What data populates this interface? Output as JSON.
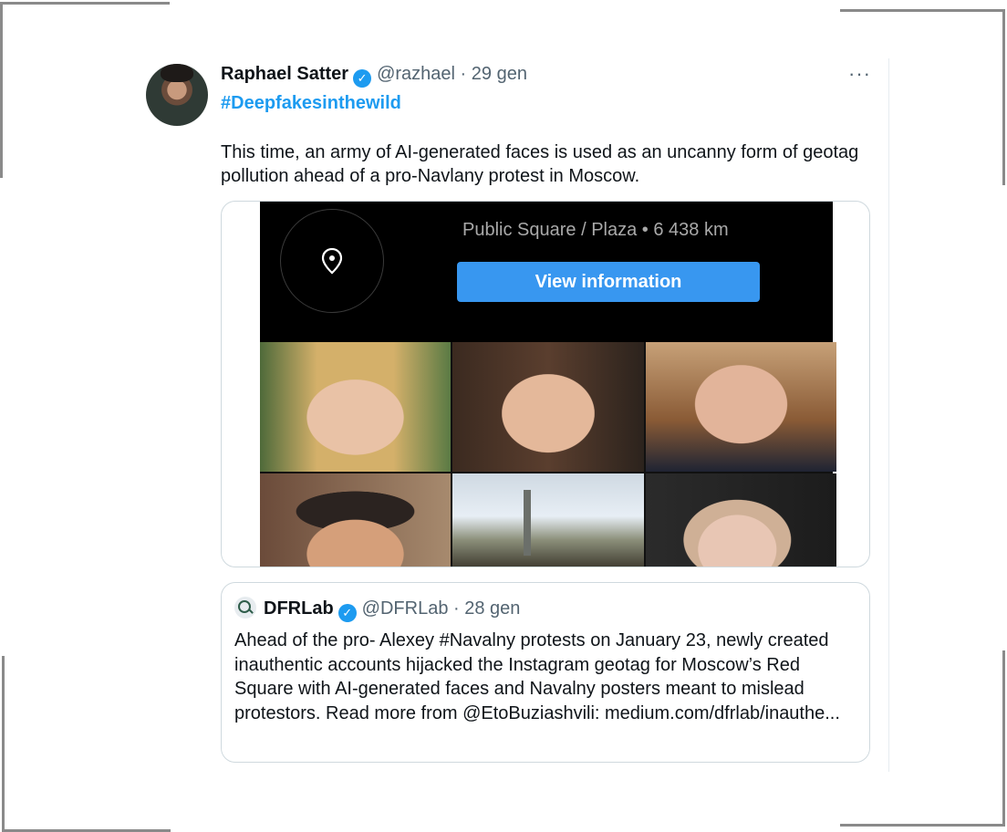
{
  "tweet": {
    "author_name": "Raphael Satter",
    "verified_glyph": "✓",
    "handle": "@razhael",
    "separator": "·",
    "time": "29 gen",
    "more_glyph": "···",
    "hashtag": "#Deepfakesinthewild",
    "text": "This time, an army of AI-generated faces is used as an uncanny form of geotag pollution ahead of a pro-Navlany protest in Moscow."
  },
  "media": {
    "location_text": "Public Square / Plaza • 6 438 km",
    "view_button": "View information",
    "pin_icon": "location-pin-icon"
  },
  "quote": {
    "author_name": "DFRLab",
    "verified_glyph": "✓",
    "handle": "@DFRLab",
    "separator": "·",
    "time": "28 gen",
    "text": "Ahead of the pro- Alexey #Navalny protests on January 23, newly created inauthentic accounts hijacked the Instagram geotag for Moscow’s Red Square with AI-generated faces and Navalny posters meant to mislead protestors. Read more from @EtoBuziashvili: medium.com/dfrlab/inauthe..."
  },
  "colors": {
    "link_blue": "#1d9bf0",
    "instagram_button": "#3897f0",
    "muted_text": "#536471"
  }
}
